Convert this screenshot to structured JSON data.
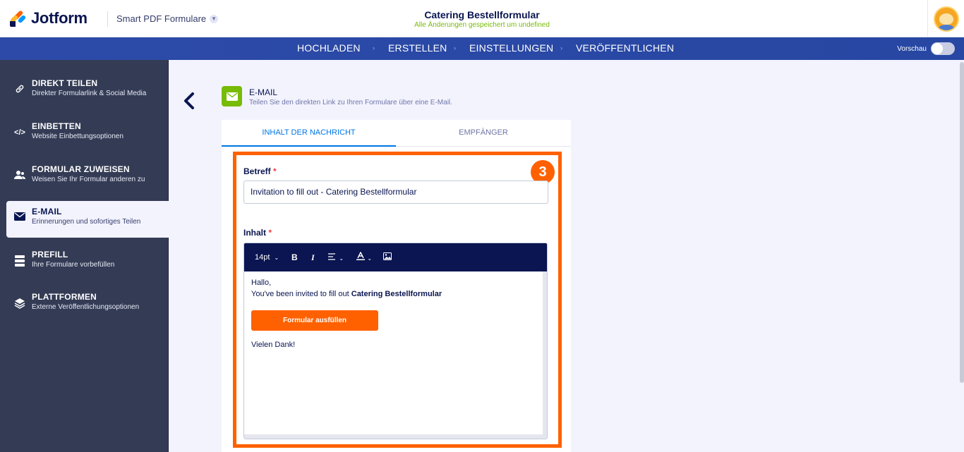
{
  "header": {
    "logo_text": "Jotform",
    "product_label": "Smart PDF Formulare",
    "form_title": "Catering Bestellformular",
    "saved_status": "Alle Änderungen gespeichert um undefined",
    "brand_colors": {
      "orange": "#ff6100",
      "blue": "#0099ff",
      "yellow": "#ffb629",
      "navy": "#0a1551"
    }
  },
  "nav": {
    "items": [
      "HOCHLADEN",
      "ERSTELLEN",
      "EINSTELLUNGEN",
      "VERÖFFENTLICHEN"
    ],
    "separator": "›",
    "preview_label": "Vorschau",
    "preview_on": false
  },
  "sidebar": {
    "items": [
      {
        "title": "DIREKT TEILEN",
        "subtitle": "Direkter Formularlink & Social Media",
        "icon": "link-icon",
        "active": false
      },
      {
        "title": "EINBETTEN",
        "subtitle": "Website Einbettungsoptionen",
        "icon": "code-icon",
        "active": false
      },
      {
        "title": "FORMULAR ZUWEISEN",
        "subtitle": "Weisen Sie Ihr Formular anderen zu",
        "icon": "users-icon",
        "active": false
      },
      {
        "title": "E-MAIL",
        "subtitle": "Erinnerungen und sofortiges Teilen",
        "icon": "envelope-icon",
        "active": true
      },
      {
        "title": "PREFILL",
        "subtitle": "Ihre Formulare vorbefüllen",
        "icon": "database-icon",
        "active": false
      },
      {
        "title": "PLATTFORMEN",
        "subtitle": "Externe Veröffentlichungsoptionen",
        "icon": "layers-icon",
        "active": false
      }
    ]
  },
  "email_section": {
    "title": "E-MAIL",
    "subtitle": "Teilen Sie den direkten Link zu Ihren Formulare über eine E-Mail.",
    "tabs": [
      {
        "label": "INHALT DER NACHRICHT",
        "active": true
      },
      {
        "label": "EMPFÄNGER",
        "active": false
      }
    ],
    "step_number": "3",
    "subject_label": "Betreff",
    "required_mark": "*",
    "subject_value": "Invitation to fill out - Catering Bestellformular",
    "content_label": "Inhalt",
    "toolbar": {
      "font_size": "14pt",
      "bold": "B",
      "italic": "I"
    },
    "body": {
      "greeting": "Hallo,",
      "invite_prefix": "You've been invited to fill out ",
      "invite_form": "Catering Bestellformular",
      "button_label": "Formular ausfüllen",
      "closing": "Vielen Dank!"
    }
  }
}
